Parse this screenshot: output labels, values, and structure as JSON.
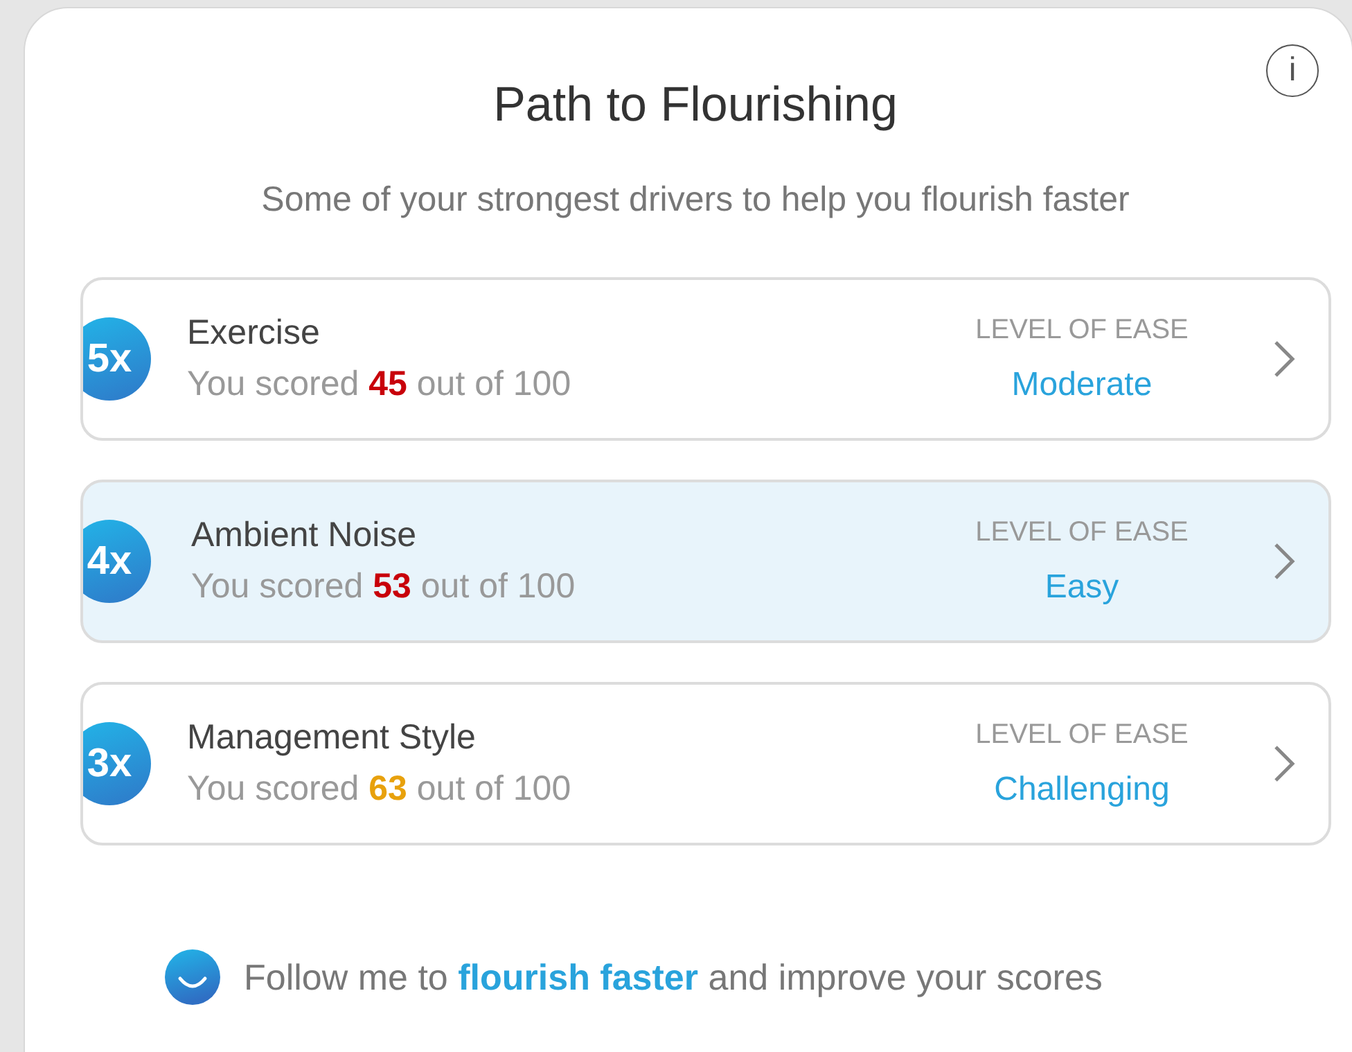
{
  "title": "Path to Flourishing",
  "info_button": "i",
  "subtitle": "Some of your strongest drivers to help you flourish faster",
  "drivers": [
    {
      "badge": "5x",
      "name": "Exercise",
      "score_prefix": "You scored",
      "score": "45",
      "score_suffix": "out of 100",
      "color": "#c8000a",
      "ease_label": "LEVEL OF EASE",
      "ease": "Moderate",
      "selected": false
    },
    {
      "badge": "4x",
      "name": "Ambient Noise",
      "score_prefix": "You scored",
      "score": "53",
      "score_suffix": "out of 100",
      "color": "#c8000a",
      "ease_label": "LEVEL OF EASE",
      "ease": "Easy",
      "selected": true
    },
    {
      "badge": "3x",
      "name": "Management Style",
      "score_prefix": "You scored",
      "score": "63",
      "score_suffix": "out of 100",
      "color": "#e8a10c",
      "ease_label": "LEVEL OF EASE",
      "ease": "Challenging",
      "selected": false
    }
  ],
  "footer": {
    "prefix": "Follow me to",
    "link": "flourish faster",
    "suffix": "and improve your scores"
  }
}
